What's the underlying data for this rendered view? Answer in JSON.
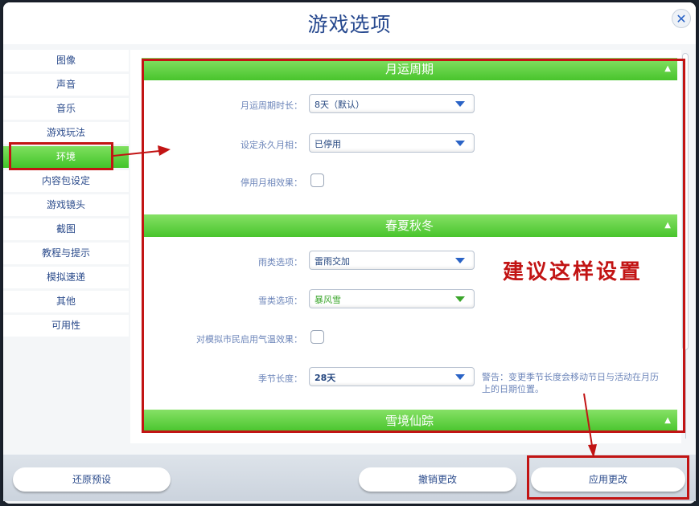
{
  "dialog": {
    "title": "游戏选项",
    "close_icon": "close-icon"
  },
  "sidebar": {
    "items": [
      {
        "label": "图像"
      },
      {
        "label": "声音"
      },
      {
        "label": "音乐"
      },
      {
        "label": "游戏玩法"
      },
      {
        "label": "环境",
        "active": true
      },
      {
        "label": "内容包设定"
      },
      {
        "label": "游戏镜头"
      },
      {
        "label": "截图"
      },
      {
        "label": "教程与提示"
      },
      {
        "label": "模拟速递"
      },
      {
        "label": "其他"
      },
      {
        "label": "可用性"
      }
    ]
  },
  "sections": {
    "lunar": {
      "title": "月运周期",
      "cycle_length_label": "月运周期时长：",
      "cycle_length_value": "8天（默认）",
      "permanent_phase_label": "设定永久月相：",
      "permanent_phase_value": "已停用",
      "disable_effects_label": "停用月相效果："
    },
    "seasons": {
      "title": "春夏秋冬",
      "rain_label": "雨类选项：",
      "rain_value": "雷雨交加",
      "snow_label": "雪类选项：",
      "snow_value": "暴风雪",
      "temp_effects_label": "对模拟市民启用气温效果：",
      "season_length_label": "季节长度：",
      "season_length_value": "28天",
      "warning": "警告：变更季节长度会移动节日与活动在月历上的日期位置。"
    },
    "snowy_escape": {
      "title": "雪境仙踪"
    }
  },
  "footer": {
    "reset_label": "还原预设",
    "cancel_label": "撤销更改",
    "apply_label": "应用更改"
  },
  "annotation": {
    "text": "建议这样设置",
    "color": "#c21414"
  },
  "colors": {
    "accent_green": "#48c42c",
    "title_blue": "#27498f",
    "text_blue": "#2c4c8c"
  }
}
